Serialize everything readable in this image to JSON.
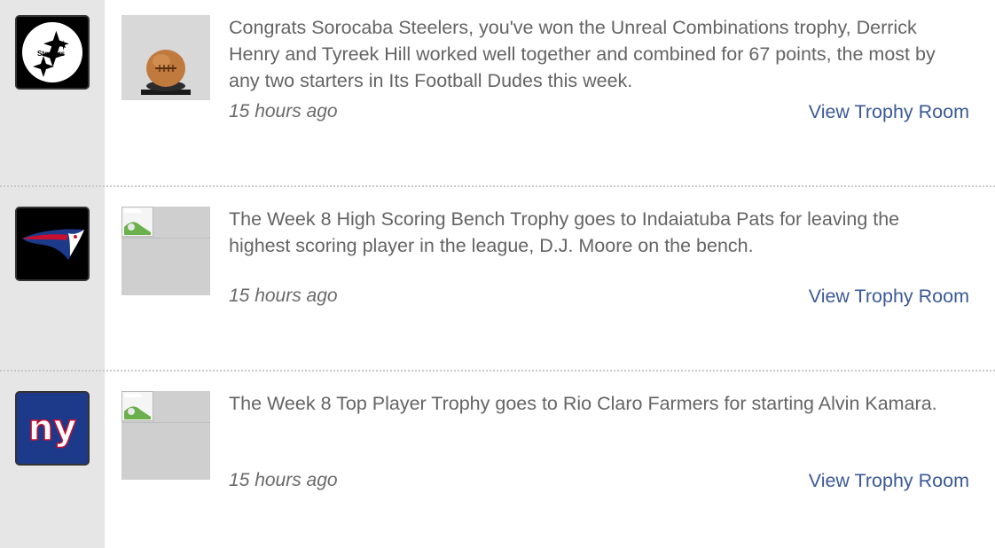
{
  "feed": [
    {
      "team_logo": "steelers-logo",
      "trophy_image": "football-trophy",
      "message": "Congrats Sorocaba Steelers, you've won the Unreal Combinations trophy, Derrick Henry and Tyreek Hill worked well together and combined for 67 points, the most by any two starters in Its Football Dudes this week.",
      "timestamp": "15 hours ago",
      "link_label": "View Trophy Room"
    },
    {
      "team_logo": "patriots-logo",
      "trophy_image": "broken-image-icon",
      "message": "The Week 8 High Scoring Bench Trophy goes to Indaiatuba Pats for leaving the highest scoring player in the league, D.J. Moore on the bench.",
      "timestamp": "15 hours ago",
      "link_label": "View Trophy Room"
    },
    {
      "team_logo": "giants-logo",
      "trophy_image": "broken-image-icon",
      "message": "The Week 8 Top Player Trophy goes to Rio Claro Farmers for starting Alvin Kamara.",
      "timestamp": "15 hours ago",
      "link_label": "View Trophy Room"
    }
  ],
  "logos": {
    "steelers_text": "Steelers",
    "giants_text": "ny"
  },
  "colors": {
    "link": "#3b5998",
    "text": "#646464",
    "sidebar": "#e6e6e6"
  }
}
